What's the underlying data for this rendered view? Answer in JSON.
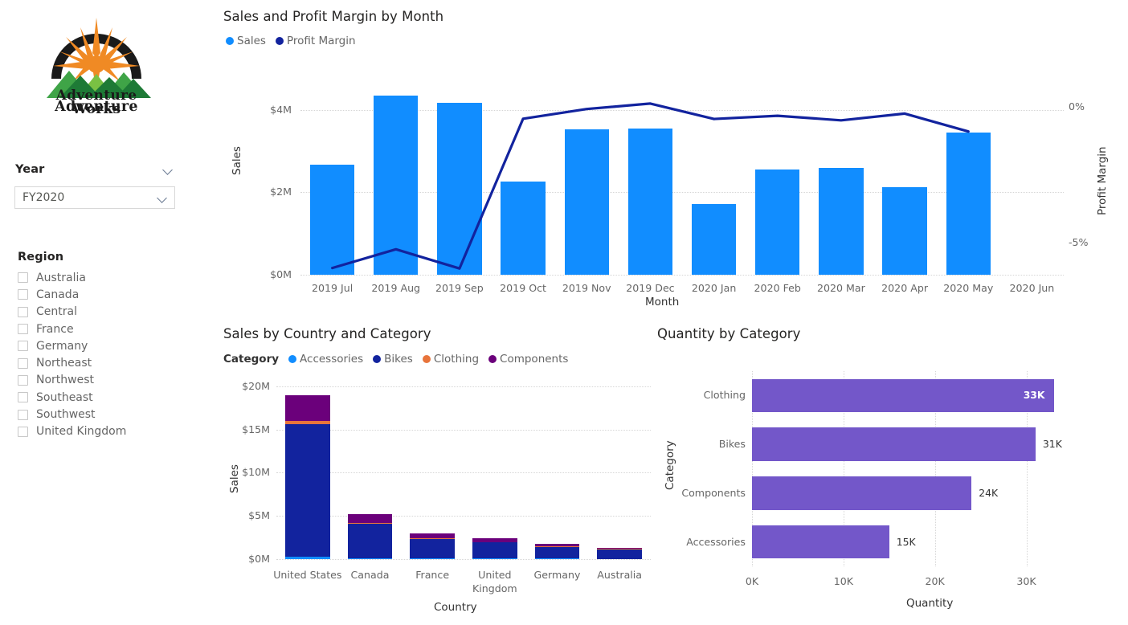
{
  "brand": {
    "logo_name": "adventure-works-logo",
    "line1": "Adventure",
    "line2": "Works",
    "colors": {
      "arc": "#1a1a1a",
      "sun": "#F08A24",
      "mountain_dark": "#1E7A36",
      "mountain_mid": "#3FA447",
      "mountain_light": "#7AC143"
    }
  },
  "slicers": {
    "year": {
      "label": "Year",
      "selected": "FY2020",
      "options": [
        "FY2020"
      ],
      "expand_icon": "chevron-down-icon",
      "dropdown_icon": "chevron-down-icon"
    },
    "region": {
      "label": "Region",
      "items": [
        {
          "label": "Australia",
          "checked": false
        },
        {
          "label": "Canada",
          "checked": false
        },
        {
          "label": "Central",
          "checked": false
        },
        {
          "label": "France",
          "checked": false
        },
        {
          "label": "Germany",
          "checked": false
        },
        {
          "label": "Northeast",
          "checked": false
        },
        {
          "label": "Northwest",
          "checked": false
        },
        {
          "label": "Southeast",
          "checked": false
        },
        {
          "label": "Southwest",
          "checked": false
        },
        {
          "label": "United Kingdom",
          "checked": false
        }
      ]
    }
  },
  "palette": {
    "sales_blue": "#118DFF",
    "profit_navy": "#12239E",
    "accessories": "#118DFF",
    "bikes": "#12239E",
    "clothing": "#E8743B",
    "components": "#6B007B",
    "quantity_purple": "#7357C9"
  },
  "chart_data": [
    {
      "id": "sales-and-profit-margin-by-month",
      "type": "bar",
      "title": "Sales and Profit Margin by Month",
      "xlabel": "Month",
      "ylabel": "Sales",
      "y2label": "Profit Margin",
      "grid": true,
      "legend_position": "top-left",
      "categories": [
        "2019 Jul",
        "2019 Aug",
        "2019 Sep",
        "2019 Oct",
        "2019 Nov",
        "2019 Dec",
        "2020 Jan",
        "2020 Feb",
        "2020 Mar",
        "2020 Apr",
        "2020 May",
        "2020 Jun"
      ],
      "ylim": [
        0,
        4.6
      ],
      "yticks": [
        "$0M",
        "$2M",
        "$4M"
      ],
      "ytick_values": [
        0,
        2,
        4
      ],
      "y2lim": [
        -6.2,
        0.8
      ],
      "y2ticks": [
        "0%",
        "-5%"
      ],
      "y2tick_values": [
        0,
        -5
      ],
      "series": [
        {
          "name": "Sales",
          "type": "bar",
          "color": "#118DFF",
          "values": [
            2.67,
            4.34,
            4.17,
            2.26,
            3.53,
            3.55,
            1.72,
            2.55,
            2.6,
            2.13,
            3.45,
            null
          ]
        },
        {
          "name": "Profit Margin",
          "type": "line",
          "color": "#12239E",
          "values": [
            -5.95,
            -5.26,
            -5.97,
            -0.44,
            -0.08,
            0.12,
            -0.45,
            -0.33,
            -0.5,
            -0.25,
            -0.91,
            null
          ]
        }
      ]
    },
    {
      "id": "sales-by-country-and-category",
      "type": "bar",
      "stacked": true,
      "title": "Sales by Country and Category",
      "xlabel": "Country",
      "ylabel": "Sales",
      "grid": true,
      "legend_title": "Category",
      "legend_position": "top-left",
      "categories": [
        "United States",
        "Canada",
        "France",
        "United Kingdom",
        "Germany",
        "Australia"
      ],
      "ylim": [
        0,
        21.2
      ],
      "yticks": [
        "$0M",
        "$5M",
        "$10M",
        "$15M",
        "$20M"
      ],
      "ytick_values": [
        0,
        5,
        10,
        15,
        20
      ],
      "series": [
        {
          "name": "Accessories",
          "color": "#118DFF",
          "values": [
            0.3,
            0.1,
            0.08,
            0.07,
            0.05,
            0.04
          ]
        },
        {
          "name": "Bikes",
          "color": "#12239E",
          "values": [
            15.35,
            3.95,
            2.22,
            1.84,
            1.35,
            1.1
          ]
        },
        {
          "name": "Clothing",
          "color": "#E8743B",
          "values": [
            0.35,
            0.15,
            0.1,
            0.07,
            0.05,
            0.04
          ]
        },
        {
          "name": "Components",
          "color": "#6B007B",
          "values": [
            2.95,
            1.05,
            0.62,
            0.47,
            0.3,
            0.12
          ]
        }
      ]
    },
    {
      "id": "quantity-by-category",
      "type": "bar",
      "orientation": "horizontal",
      "title": "Quantity by Category",
      "xlabel": "Quantity",
      "ylabel": "Category",
      "grid": true,
      "categories": [
        "Clothing",
        "Bikes",
        "Components",
        "Accessories"
      ],
      "values": [
        33,
        31,
        24,
        15
      ],
      "data_labels": [
        "33K",
        "31K",
        "24K",
        "15K"
      ],
      "label_inside": [
        true,
        false,
        false,
        false
      ],
      "xlim": [
        0,
        32.5
      ],
      "xticks": [
        "0K",
        "10K",
        "20K",
        "30K"
      ],
      "xtick_values": [
        0,
        10,
        20,
        30
      ],
      "color": "#7357C9"
    }
  ]
}
